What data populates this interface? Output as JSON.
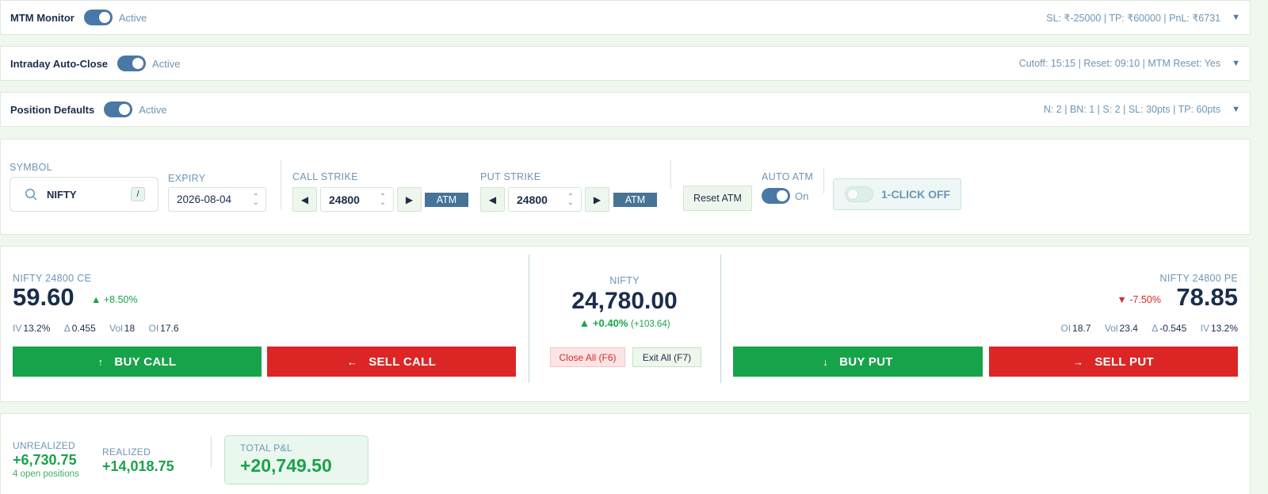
{
  "mtm": {
    "title": "MTM Monitor",
    "state": "Active",
    "summary": "SL: ₹-25000 | TP: ₹60000 | PnL: ₹6731"
  },
  "intraday": {
    "title": "Intraday Auto-Close",
    "state": "Active",
    "summary": "Cutoff: 15:15 | Reset: 09:10 | MTM Reset: Yes"
  },
  "defaults": {
    "title": "Position Defaults",
    "state": "Active",
    "summary": "N: 2 | BN: 1 | S: 2 | SL: 30pts | TP: 60pts"
  },
  "controls": {
    "symbol_label": "SYMBOL",
    "symbol_value": "NIFTY",
    "symbol_shortcut": "/",
    "expiry_label": "EXPIRY",
    "expiry_value": "2026-08-04",
    "call_strike_label": "CALL STRIKE",
    "call_strike_value": "24800",
    "put_strike_label": "PUT STRIKE",
    "put_strike_value": "24800",
    "atm_label": "ATM",
    "reset_atm_label": "Reset ATM",
    "auto_atm_label": "AUTO ATM",
    "auto_atm_state": "On",
    "one_click_label": "1-CLICK OFF"
  },
  "call": {
    "name": "NIFTY 24800 CE",
    "price": "59.60",
    "change": "+8.50%",
    "iv_label": "IV",
    "iv": "13.2%",
    "delta_label": "Δ",
    "delta": "0.455",
    "vol_label": "Vol",
    "vol": "18",
    "oi_label": "OI",
    "oi": "17.6",
    "buy_label": "BUY CALL",
    "sell_label": "SELL CALL"
  },
  "index": {
    "name": "NIFTY",
    "price": "24,780.00",
    "change_pct": "+0.40%",
    "change_abs": "(+103.64)",
    "close_all": "Close All (F6)",
    "exit_all": "Exit All (F7)"
  },
  "put": {
    "name": "NIFTY 24800 PE",
    "price": "78.85",
    "change": "-7.50%",
    "oi_label": "OI",
    "oi": "18.7",
    "vol_label": "Vol",
    "vol": "23.4",
    "delta_label": "Δ",
    "delta": "-0.545",
    "iv_label": "IV",
    "iv": "13.2%",
    "buy_label": "BUY PUT",
    "sell_label": "SELL PUT"
  },
  "pnl": {
    "unrealized_label": "UNREALIZED",
    "unrealized": "+6,730.75",
    "positions": "4 open positions",
    "realized_label": "REALIZED",
    "realized": "+14,018.75",
    "total_label": "TOTAL P&L",
    "total": "+20,749.50"
  },
  "colors": {
    "buy": "#17a34a",
    "sell": "#dc2626",
    "accent": "#467396"
  }
}
